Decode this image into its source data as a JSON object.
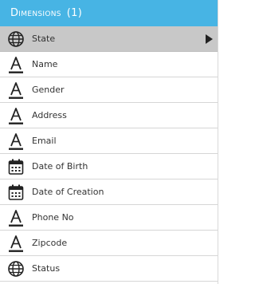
{
  "header": {
    "title": "Dimensions",
    "count": "(1)"
  },
  "colors": {
    "header_bg": "#47b4e4",
    "selected_bg": "#c8c8c8"
  },
  "items": [
    {
      "label": "State",
      "icon": "globe-icon",
      "selected": true
    },
    {
      "label": "Name",
      "icon": "text-icon"
    },
    {
      "label": "Gender",
      "icon": "text-icon"
    },
    {
      "label": "Address",
      "icon": "text-icon"
    },
    {
      "label": "Email",
      "icon": "text-icon"
    },
    {
      "label": "Date of Birth",
      "icon": "calendar-icon"
    },
    {
      "label": "Date of Creation",
      "icon": "calendar-icon"
    },
    {
      "label": "Phone No",
      "icon": "text-icon"
    },
    {
      "label": "Zipcode",
      "icon": "text-icon"
    },
    {
      "label": "Status",
      "icon": "globe-icon"
    }
  ]
}
